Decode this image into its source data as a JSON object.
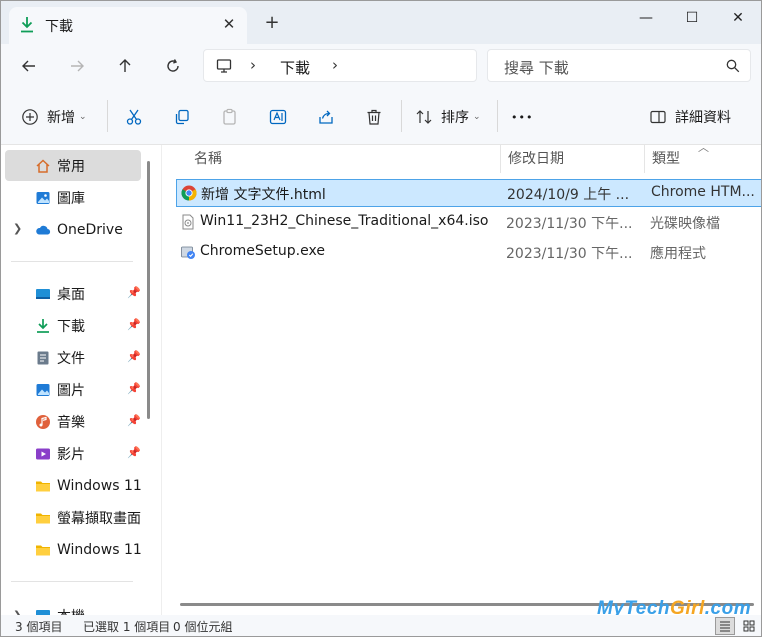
{
  "window": {
    "tab_title": "下載",
    "tab_close": "✕",
    "new_tab": "+",
    "minimize": "—",
    "maximize": "☐",
    "close": "✕"
  },
  "address": {
    "path_segment": "下載",
    "separator": "›",
    "search_placeholder": "搜尋 下載"
  },
  "toolbar": {
    "new_label": "新增",
    "sort_label": "排序",
    "more_label": "•••",
    "details_label": "詳細資料"
  },
  "sidebar": {
    "items": [
      {
        "label": "常用"
      },
      {
        "label": "圖庫"
      },
      {
        "label": "OneDrive"
      },
      {
        "label": "桌面"
      },
      {
        "label": "下載"
      },
      {
        "label": "文件"
      },
      {
        "label": "圖片"
      },
      {
        "label": "音樂"
      },
      {
        "label": "影片"
      },
      {
        "label": "Windows 11"
      },
      {
        "label": "螢幕擷取畫面"
      },
      {
        "label": "Windows 11"
      },
      {
        "label": "本機"
      }
    ]
  },
  "columns": {
    "name": "名稱",
    "date": "修改日期",
    "type": "類型"
  },
  "files": [
    {
      "name": "新增 文字文件.html",
      "date": "2024/10/9 上午 ...",
      "type": "Chrome HTM..."
    },
    {
      "name": "Win11_23H2_Chinese_Traditional_x64.iso",
      "date": "2023/11/30 下午...",
      "type": "光碟映像檔"
    },
    {
      "name": "ChromeSetup.exe",
      "date": "2023/11/30 下午...",
      "type": "應用程式"
    }
  ],
  "status": {
    "item_count": "3 個項目",
    "selected": "已選取 1 個項目",
    "size": "0 個位元組"
  },
  "watermark": {
    "part1": "MyTech",
    "part2": "Girl",
    "part3": ".com"
  },
  "colors": {
    "accent": "#0067c0",
    "selection": "#cce8ff",
    "folder": "#f0b400"
  }
}
